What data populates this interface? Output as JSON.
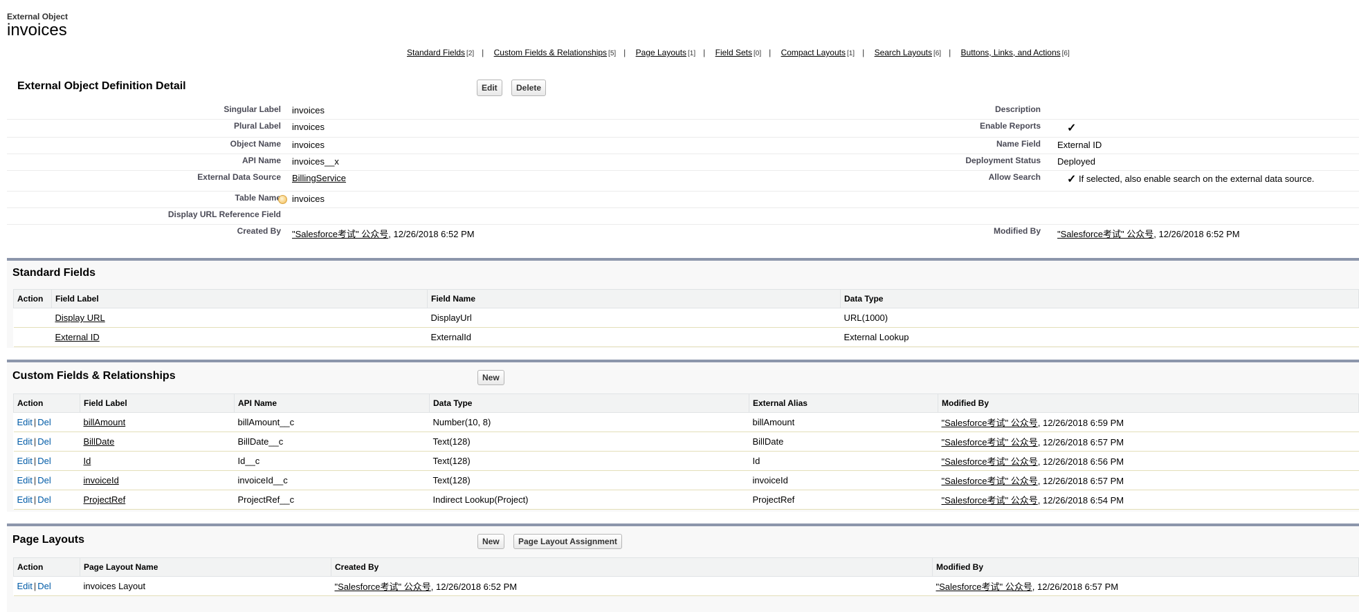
{
  "header": {
    "object_type": "External Object",
    "object_name": "invoices"
  },
  "related_links": [
    {
      "label": "Standard Fields",
      "count": "[2]"
    },
    {
      "label": "Custom Fields & Relationships",
      "count": "[5]"
    },
    {
      "label": "Page Layouts",
      "count": "[1]"
    },
    {
      "label": "Field Sets",
      "count": "[0]"
    },
    {
      "label": "Compact Layouts",
      "count": "[1]"
    },
    {
      "label": "Search Layouts",
      "count": "[6]"
    },
    {
      "label": "Buttons, Links, and Actions",
      "count": "[6]"
    }
  ],
  "detail": {
    "title": "External Object Definition Detail",
    "edit_label": "Edit",
    "delete_label": "Delete",
    "singular_label": {
      "label": "Singular Label",
      "value": "invoices"
    },
    "plural_label": {
      "label": "Plural Label",
      "value": "invoices"
    },
    "object_name": {
      "label": "Object Name",
      "value": "invoices"
    },
    "api_name": {
      "label": "API Name",
      "value": "invoices__x"
    },
    "external_data_source": {
      "label": "External Data Source",
      "value": "BillingService"
    },
    "table_name": {
      "label": "Table Name",
      "value": "invoices"
    },
    "display_url_ref": {
      "label": "Display URL Reference Field",
      "value": ""
    },
    "created_by": {
      "label": "Created By",
      "user": "\"Salesforce考试\" 公众号",
      "date": ", 12/26/2018 6:52 PM"
    },
    "description": {
      "label": "Description",
      "value": ""
    },
    "enable_reports": {
      "label": "Enable Reports",
      "checked": true
    },
    "name_field": {
      "label": "Name Field",
      "value": "External ID"
    },
    "deployment_status": {
      "label": "Deployment Status",
      "value": "Deployed"
    },
    "allow_search": {
      "label": "Allow Search",
      "checked": true,
      "note": "If selected, also enable search on the external data source."
    },
    "modified_by": {
      "label": "Modified By",
      "user": "\"Salesforce考试\" 公众号",
      "date": ", 12/26/2018 6:52 PM"
    }
  },
  "standard_fields": {
    "title": "Standard Fields",
    "columns": [
      "Action",
      "Field Label",
      "Field Name",
      "Data Type"
    ],
    "rows": [
      {
        "label": "Display URL",
        "name": "DisplayUrl",
        "type": "URL(1000)"
      },
      {
        "label": "External ID",
        "name": "ExternalId",
        "type": "External Lookup"
      }
    ]
  },
  "custom_fields": {
    "title": "Custom Fields & Relationships",
    "new_label": "New",
    "columns": [
      "Action",
      "Field Label",
      "API Name",
      "Data Type",
      "External Alias",
      "Modified By"
    ],
    "edit": "Edit",
    "del": "Del",
    "bar": "|",
    "rows": [
      {
        "label": "billAmount",
        "api": "billAmount__c",
        "type": "Number(10, 8)",
        "alias": "billAmount",
        "user": "\"Salesforce考试\" 公众号",
        "date": ", 12/26/2018 6:59 PM"
      },
      {
        "label": "BillDate",
        "api": "BillDate__c",
        "type": "Text(128)",
        "alias": "BillDate",
        "user": "\"Salesforce考试\" 公众号",
        "date": ", 12/26/2018 6:57 PM"
      },
      {
        "label": "Id",
        "api": "Id__c",
        "type": "Text(128)",
        "alias": "Id",
        "user": "\"Salesforce考试\" 公众号",
        "date": ", 12/26/2018 6:56 PM"
      },
      {
        "label": "invoiceId",
        "api": "invoiceId__c",
        "type": "Text(128)",
        "alias": "invoiceId",
        "user": "\"Salesforce考试\" 公众号",
        "date": ", 12/26/2018 6:57 PM"
      },
      {
        "label": "ProjectRef",
        "api": "ProjectRef__c",
        "type": "Indirect Lookup(Project)",
        "alias": "ProjectRef",
        "user": "\"Salesforce考试\" 公众号",
        "date": ", 12/26/2018 6:54 PM"
      }
    ]
  },
  "page_layouts": {
    "title": "Page Layouts",
    "new_label": "New",
    "assignment_label": "Page Layout Assignment",
    "columns": [
      "Action",
      "Page Layout Name",
      "Created By",
      "Modified By"
    ],
    "edit": "Edit",
    "del": "Del",
    "bar": "|",
    "rows": [
      {
        "name": "invoices Layout",
        "created_user": "\"Salesforce考试\" 公众号",
        "created_date": ", 12/26/2018 6:52 PM",
        "modified_user": "\"Salesforce考试\" 公众号",
        "modified_date": ", 12/26/2018 6:57 PM"
      }
    ]
  }
}
